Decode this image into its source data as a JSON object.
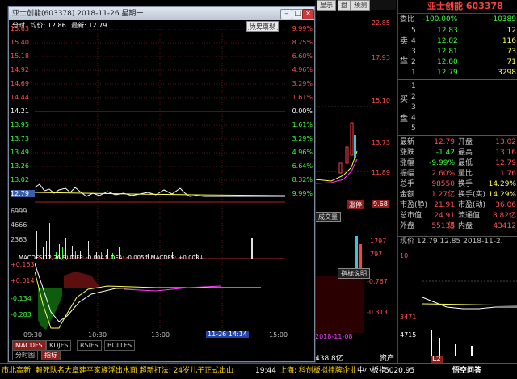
{
  "background": {
    "top_buttons": [
      "显示",
      "盘",
      "预测"
    ],
    "right_axis": [
      "22.85",
      "17.93",
      "15.10",
      "13.73",
      "11.89"
    ],
    "bottom_right_labels": [
      "1797",
      "797",
      "-0.767",
      "-0.313"
    ],
    "chip_price": "9.68",
    "rise_label": "涨停",
    "indicator_tab": "成交量",
    "indicator_button": "指标说明",
    "date_tag": "2018-11-08",
    "bottom_amount": "438.8亿",
    "bottom_text": "资产"
  },
  "window": {
    "title": "亚士创能(603378)  2018-11-26 星期一",
    "header_time": "分时",
    "header_avg": "均价: 12.86",
    "header_last": "最新: 12.79",
    "history_button": "历史重现",
    "left_prices": [
      "15.63",
      "15.40",
      "15.18",
      "14.92",
      "14.69",
      "14.44",
      "14.21",
      "13.95",
      "13.73",
      "13.49",
      "13.26",
      "13.02",
      "12.79"
    ],
    "right_pcts": [
      "9.99%",
      "8.25%",
      "6.60%",
      "4.96%",
      "3.29%",
      "1.61%",
      "0.00%",
      "1.61%",
      "3.29%",
      "4.96%",
      "6.64%",
      "8.32%",
      "9.99%"
    ],
    "volume_labels": [
      "6999",
      "4666",
      "2363"
    ],
    "macd_header": "MACDFS(12,26,9)  DIFF: -0.004↑  DEA: -0.005↑  MACDFS: +0.003↓",
    "macd_labels": [
      "+0.163",
      "+0.014",
      "-0.134",
      "-0.283"
    ],
    "time_labels": [
      "09:30",
      "10:30",
      "13:00",
      "15:00"
    ],
    "time_tag": "11-26 14:14",
    "bottom_tabs": [
      "MACDFS",
      "KDJFS",
      "RSIFS",
      "BOLLFS"
    ],
    "bottom_tabs2": [
      "分时图",
      "指标"
    ]
  },
  "quote": {
    "title": "亚士创能 603378",
    "webi_label": "委比",
    "webi_val": "-100.00%",
    "wecha_val": "-10389",
    "sell_side": "卖盘",
    "sell": [
      {
        "lvl": "5",
        "price": "12.83",
        "vol": "12"
      },
      {
        "lvl": "4",
        "price": "12.82",
        "vol": "116"
      },
      {
        "lvl": "3",
        "price": "12.81",
        "vol": "73"
      },
      {
        "lvl": "2",
        "price": "12.80",
        "vol": "71"
      },
      {
        "lvl": "1",
        "price": "12.79",
        "vol": "3298"
      }
    ],
    "buy_side": "买盘",
    "buy_levels": [
      "1",
      "2",
      "3",
      "4",
      "5"
    ],
    "stats": [
      [
        "最新",
        "12.79",
        "开盘",
        "13.02"
      ],
      [
        "涨跌",
        "-1.42",
        "最高",
        "13.16"
      ],
      [
        "涨幅",
        "-9.99%",
        "最低",
        "12.79"
      ],
      [
        "振幅",
        "2.60%",
        "量比",
        "1.76"
      ],
      [
        "总手",
        "98550",
        "换手",
        "14.29%"
      ],
      [
        "金额",
        "1.27亿",
        "换手(实)",
        "14.29%"
      ],
      [
        "市盈(静)",
        "21.91",
        "市盈(动)",
        "36.06"
      ],
      [
        "总市值",
        "24.91亿",
        "流通值",
        "8.82亿"
      ],
      [
        "外盘",
        "55139",
        "内盘",
        "43412"
      ]
    ],
    "bottom_line": "现价 12.79  12.85  2018-11-2.",
    "mini_labels": [
      "10",
      "3471",
      "4715",
      "L2"
    ]
  },
  "status": {
    "ticker": "市北高新: 赖死队名大章建平家族浮出水面 超新打法: 24岁儿子正式出山",
    "time": "19:44",
    "news": "上海: 科创板拟挂牌企业名",
    "index_name": "中小板指",
    "index_val": "5020.95",
    "right_text": "悟空问答"
  }
}
